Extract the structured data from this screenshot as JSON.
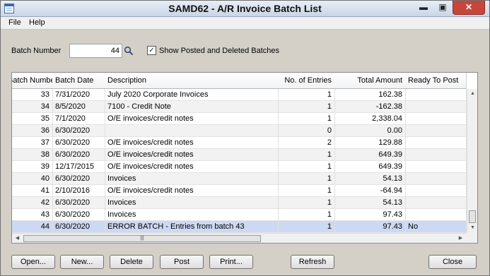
{
  "window": {
    "title": "SAMD62 - A/R Invoice Batch List",
    "controls": {
      "minimize": "▬",
      "maximize": "▣",
      "close": "✕"
    },
    "icon": "window-app-icon"
  },
  "menu": {
    "items": [
      "File",
      "Help"
    ]
  },
  "filters": {
    "batch_number_label": "Batch Number",
    "batch_number_value": "44",
    "search_icon": "search-icon",
    "show_posted_label": "Show Posted and Deleted Batches",
    "show_posted_checked": true,
    "check_mark": "✓"
  },
  "grid": {
    "columns": [
      "Batch Number",
      "Batch Date",
      "Description",
      "No. of Entries",
      "Total Amount",
      "Ready To Post"
    ],
    "rows": [
      {
        "batch": "33",
        "date": "7/31/2020",
        "description": "July 2020 Corporate Invoices",
        "entries": "1",
        "amount": "162.38",
        "ready": ""
      },
      {
        "batch": "34",
        "date": "8/5/2020",
        "description": "7100 - Credit Note",
        "entries": "1",
        "amount": "-162.38",
        "ready": ""
      },
      {
        "batch": "35",
        "date": "7/1/2020",
        "description": "O/E invoices/credit notes",
        "entries": "1",
        "amount": "2,338.04",
        "ready": ""
      },
      {
        "batch": "36",
        "date": "6/30/2020",
        "description": "",
        "entries": "0",
        "amount": "0.00",
        "ready": ""
      },
      {
        "batch": "37",
        "date": "6/30/2020",
        "description": "O/E invoices/credit notes",
        "entries": "2",
        "amount": "129.88",
        "ready": ""
      },
      {
        "batch": "38",
        "date": "6/30/2020",
        "description": "O/E invoices/credit notes",
        "entries": "1",
        "amount": "649.39",
        "ready": ""
      },
      {
        "batch": "39",
        "date": "12/17/2015",
        "description": "O/E invoices/credit notes",
        "entries": "1",
        "amount": "649.39",
        "ready": ""
      },
      {
        "batch": "40",
        "date": "6/30/2020",
        "description": "Invoices",
        "entries": "1",
        "amount": "54.13",
        "ready": ""
      },
      {
        "batch": "41",
        "date": "2/10/2016",
        "description": "O/E invoices/credit notes",
        "entries": "1",
        "amount": "-64.94",
        "ready": ""
      },
      {
        "batch": "42",
        "date": "6/30/2020",
        "description": "Invoices",
        "entries": "1",
        "amount": "54.13",
        "ready": ""
      },
      {
        "batch": "43",
        "date": "6/30/2020",
        "description": "Invoices",
        "entries": "1",
        "amount": "97.43",
        "ready": ""
      },
      {
        "batch": "44",
        "date": "6/30/2020",
        "description": "ERROR BATCH - Entries from batch 43",
        "entries": "1",
        "amount": "97.43",
        "ready": "No"
      }
    ],
    "selected_batch": "44",
    "scroll": {
      "up": "▲",
      "down": "▼",
      "left": "◀",
      "right": "▶",
      "grip": "|||"
    }
  },
  "buttons": [
    "Open...",
    "New...",
    "Delete",
    "Post",
    "Print...",
    "Refresh",
    "Close"
  ]
}
